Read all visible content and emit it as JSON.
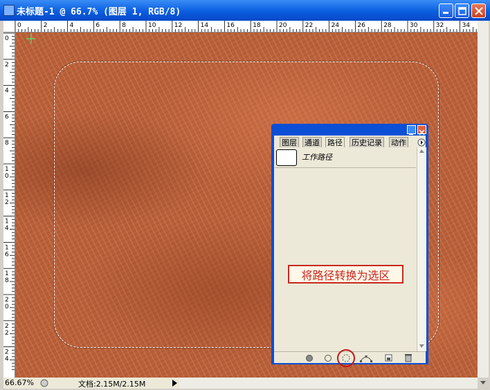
{
  "window": {
    "title": "未标题-1 @ 66.7% (图层 1, RGB/8)",
    "controls": {
      "minimize": "minimize-icon",
      "maximize": "maximize-icon",
      "close": "close-icon"
    }
  },
  "rulers": {
    "top_labels": [
      "0",
      "2",
      "4",
      "6",
      "8",
      "10",
      "12",
      "14",
      "16",
      "18",
      "20",
      "22",
      "24",
      "26",
      "28",
      "30",
      "32",
      "34"
    ],
    "left_labels": [
      "0",
      "2",
      "4",
      "6",
      "8",
      "10",
      "12",
      "14",
      "16",
      "18",
      "20",
      "22",
      "24"
    ]
  },
  "status": {
    "zoom": "66.67%",
    "doc_info": "文档:2.15M/2.15M"
  },
  "panel": {
    "tabs": [
      {
        "label": "图层"
      },
      {
        "label": "通道"
      },
      {
        "label": "路径",
        "active": true
      },
      {
        "label": "历史记录"
      },
      {
        "label": "动作"
      }
    ],
    "paths": [
      {
        "name": "工作路径"
      }
    ],
    "bottom_icons": [
      "fill-path-icon",
      "stroke-path-icon",
      "load-path-as-selection-icon",
      "make-work-path-icon",
      "new-path-icon",
      "delete-path-icon"
    ]
  },
  "annotation": {
    "text": "将路径转换为选区"
  },
  "colors": {
    "titlebar": "#0a5ee0",
    "panel_frame": "#0a4fd6",
    "annotation": "#c8281e",
    "canvas_texture": "#b8603a"
  }
}
